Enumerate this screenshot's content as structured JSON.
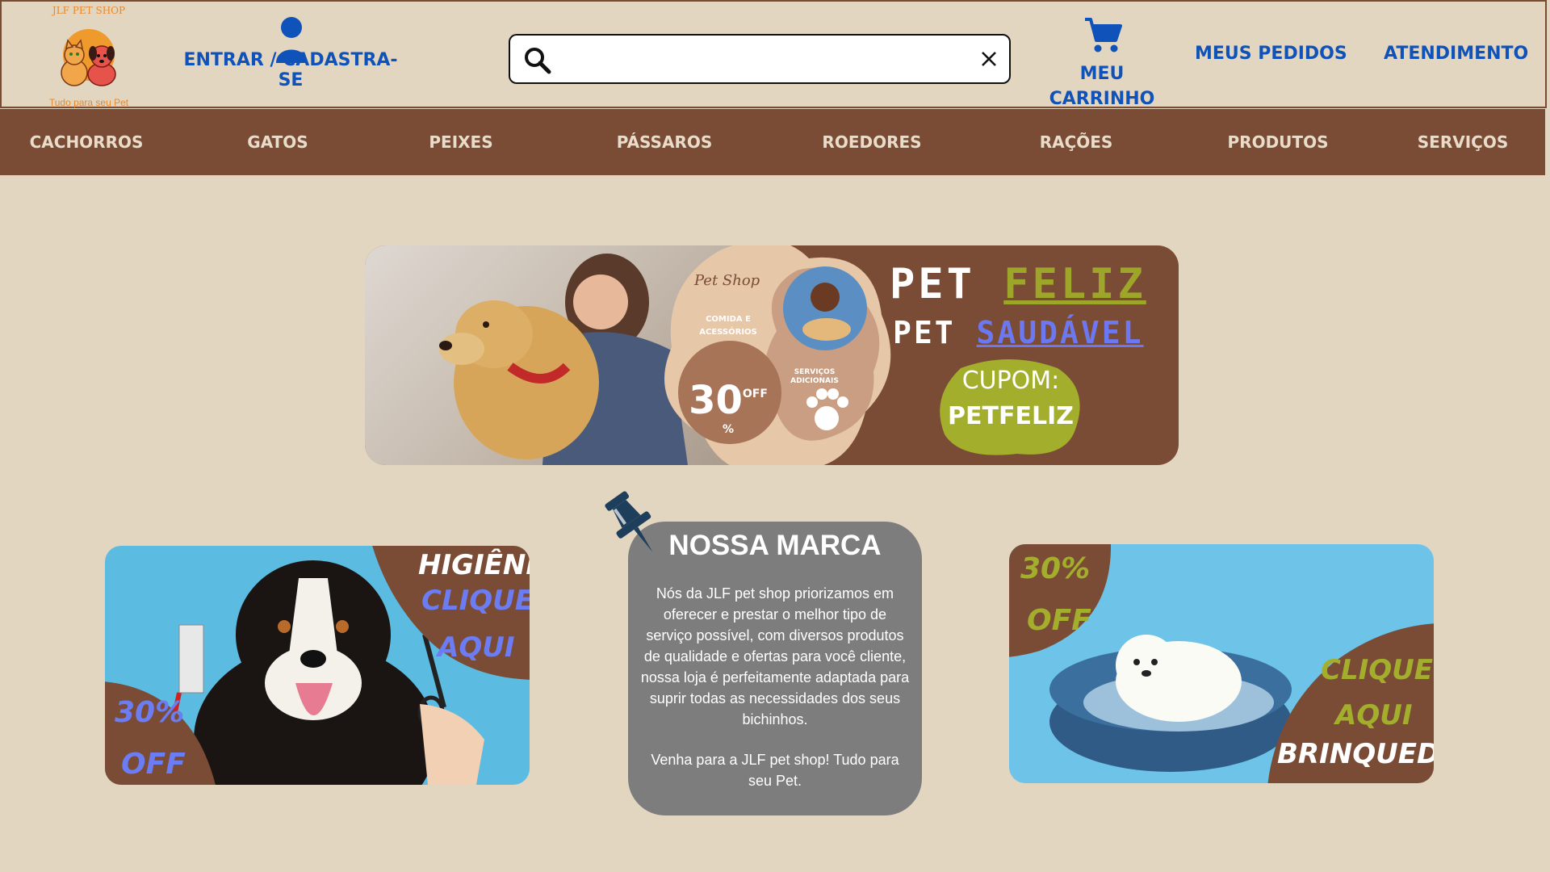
{
  "header": {
    "logo_title": "JLF PET SHOP",
    "logo_tagline": "Tudo para seu Pet",
    "login_label": "ENTRAR / CADASTRA-SE",
    "search": {
      "placeholder": "",
      "value": ""
    },
    "cart_label": "MEU\nCARRINHO",
    "orders_label": "MEUS PEDIDOS",
    "support_label": "ATENDIMENTO"
  },
  "nav": {
    "items": [
      "CACHORROS",
      "GATOS",
      "PEIXES",
      "PÁSSAROS",
      "ROEDORES",
      "RAÇÕES",
      "PRODUTOS",
      "SERVIÇOS"
    ]
  },
  "hero": {
    "word_pet_1": "PET",
    "word_feliz": "FELIZ",
    "word_pet_2": "PET",
    "word_saudavel": "SAUDÁVEL",
    "coupon_label": "CUPOM:",
    "coupon_code": "PETFELIZ",
    "petshop_script": "Pet Shop",
    "comida": "COMIDA E ACESSÓRIOS",
    "discount_number": "30",
    "discount_off": "OFF",
    "discount_pct": "%",
    "servicos": "SERVIÇOS ADICIONAIS"
  },
  "left_promo": {
    "title": "HIGIÊNE",
    "cta_line1": "CLIQUE",
    "cta_line2": "AQUI",
    "discount_line1": "30%",
    "discount_line2": "OFF"
  },
  "brand": {
    "title": "NOSSA MARCA",
    "paragraph1": "Nós da JLF pet shop priorizamos em oferecer e prestar o melhor tipo de serviço possível, com diversos produtos de qualidade e ofertas para você cliente, nossa loja é perfeitamente adaptada para suprir todas as necessidades dos seus bichinhos.",
    "paragraph2": "Venha para a JLF pet shop! Tudo para seu Pet."
  },
  "right_promo": {
    "discount_line1": "30%",
    "discount_line2": "OFF",
    "cta_line1": "CLIQUE",
    "cta_line2": "AQUI",
    "title": "BRINQUEDO"
  },
  "colors": {
    "page_bg": "#e2d6c1",
    "brown": "#7a4c35",
    "link_blue": "#0f52ba",
    "olive": "#a3ae2c",
    "promo_blue": "#6c7cf2",
    "sky": "#5bbbe0",
    "brand_box": "#7d7d7d"
  },
  "icons": [
    "user-icon",
    "search-icon",
    "close-icon",
    "cart-icon",
    "pushpin-icon",
    "paw-icon",
    "comb-icon",
    "scissors-icon"
  ]
}
